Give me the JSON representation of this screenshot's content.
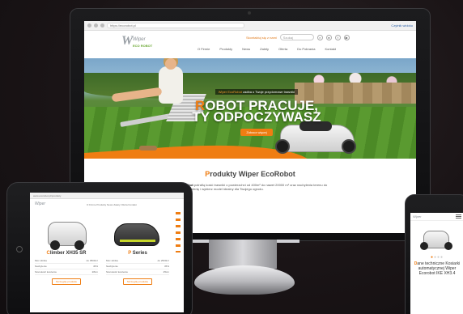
{
  "desktop": {
    "browser": {
      "url": "https://ecorobot.pl",
      "extension_label": "Czytnik widoku"
    },
    "header": {
      "logo": {
        "mark": "W",
        "name": "Wiper",
        "sub": "ECO ROBOT"
      },
      "contact_link": "Skontaktuj się z nami",
      "search_placeholder": "Szukaj",
      "icons": [
        "search-icon",
        "user-icon",
        "facebook-icon",
        "youtube-icon"
      ],
      "nav": [
        "O Firmie",
        "Produkty",
        "News",
        "Zalety",
        "Oferta",
        "Do Pobrania",
        "Kontakt"
      ]
    },
    "hero": {
      "tag_highlight": "Wiper EcoRobot",
      "tag_rest": " zadba o Twoje przydomowe trawniki",
      "headline_first_letter": "R",
      "headline_line1_rest": "OBOT PRACUJE,",
      "headline_line2": "TY ODPOCZYWASZ",
      "button": "Zobacz więcej"
    },
    "products": {
      "title_first_letter": "P",
      "title_rest": "rodukty Wiper EcoRobot",
      "intro_bold": "Wiper Ecorobot",
      "intro_rest": " potrafią kosić trawniki o powierzchni od 400m² do nawet 20000 m² oraz nachylenia terenu do 45%. Sprawdź ofertę i wybierz model idealny dla Twojego ogrodu."
    },
    "colors": {
      "accent": "#ef7d12",
      "text": "#333333"
    }
  },
  "tablet": {
    "browser": {
      "url": "www.ecorobot.pl/produkty"
    },
    "header": {
      "logo": "Wiper",
      "nav": "O Firmie  Produkty  News  Zalety  Oferta  Kontakt"
    },
    "products": [
      {
        "name_first_letter": "C",
        "name_rest": "limber XH35 SR",
        "specs": [
          {
            "label": "Moc silnika",
            "value": "do 3500m²"
          },
          {
            "label": "Nachylenie",
            "value": "45%"
          },
          {
            "label": "Szerokość koszenia",
            "value": "28cm"
          }
        ],
        "button": "Szczegóły produktu"
      },
      {
        "name_first_letter": "P",
        "name_rest": " Series",
        "specs": [
          {
            "label": "Moc silnika",
            "value": "do 2500m²"
          },
          {
            "label": "Nachylenie",
            "value": "35%"
          },
          {
            "label": "Szerokość koszenia",
            "value": "25cm"
          }
        ],
        "button": "Szczegóły produktu"
      }
    ]
  },
  "phone": {
    "logo": "Wiper",
    "carousel_dots": [
      "●",
      "●",
      "●",
      "●"
    ],
    "active_dot": 0,
    "text_first_letter": "D",
    "text_rest": "ane techniczne Kosiarki automatycznej Wiper Ecorobot IKE XH3.4"
  }
}
